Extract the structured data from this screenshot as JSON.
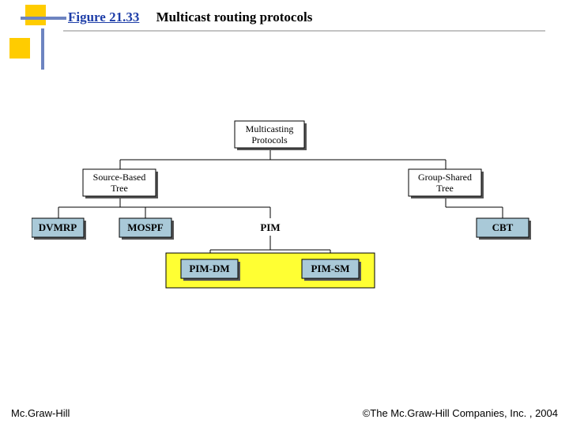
{
  "figure": {
    "label": "Figure 21.33",
    "title": "Multicast routing protocols"
  },
  "footer": {
    "left": "Mc.Graw-Hill",
    "right": "©The Mc.Graw-Hill Companies, Inc. , 2004"
  },
  "tree": {
    "root": {
      "line1": "Multicasting",
      "line2": "Protocols"
    },
    "left": {
      "line1": "Source-Based",
      "line2": "Tree"
    },
    "right": {
      "line1": "Group-Shared",
      "line2": "Tree"
    },
    "leaves": {
      "dvmrp": "DVMRP",
      "mospf": "MOSPF",
      "pim": "PIM",
      "cbt": "CBT",
      "pimdm": "PIM-DM",
      "pimsm": "PIM-SM"
    }
  }
}
